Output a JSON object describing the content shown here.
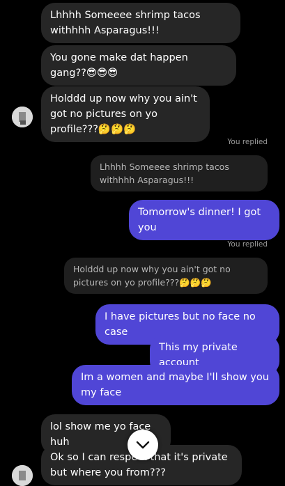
{
  "thread": {
    "msg1": "Lhhhh Someeee shrimp tacos withhhh Asparagus!!!",
    "msg2": "You gone make dat happen gang??😎😎😎",
    "msg3": "Holddd up now why you ain't got no pictures on yo profile???🤔🤔🤔",
    "replied_label_1": "You replied",
    "quote1": "Lhhhh Someeee shrimp tacos withhhh Asparagus!!!",
    "reply1": "Tomorrow's dinner! I got you",
    "replied_label_2": "You replied",
    "quote2": "Holddd up now why you ain't got no pictures on yo profile???🤔🤔🤔",
    "reply2": "I have pictures but no face no case",
    "reply3": "This my private account",
    "reply4": "Im a women and maybe I'll show you my face",
    "msg4": "lol show me yo face huh",
    "msg5": "Ok so I can respect that it's private but where you from???"
  },
  "icons": {
    "scroll_down": "chevron-down-icon",
    "avatar": "avatar"
  },
  "colors": {
    "background": "#000000",
    "incoming_bubble": "#262626",
    "outgoing_bubble": "#5046d6",
    "quote_bubble": "#1f1f1f"
  }
}
